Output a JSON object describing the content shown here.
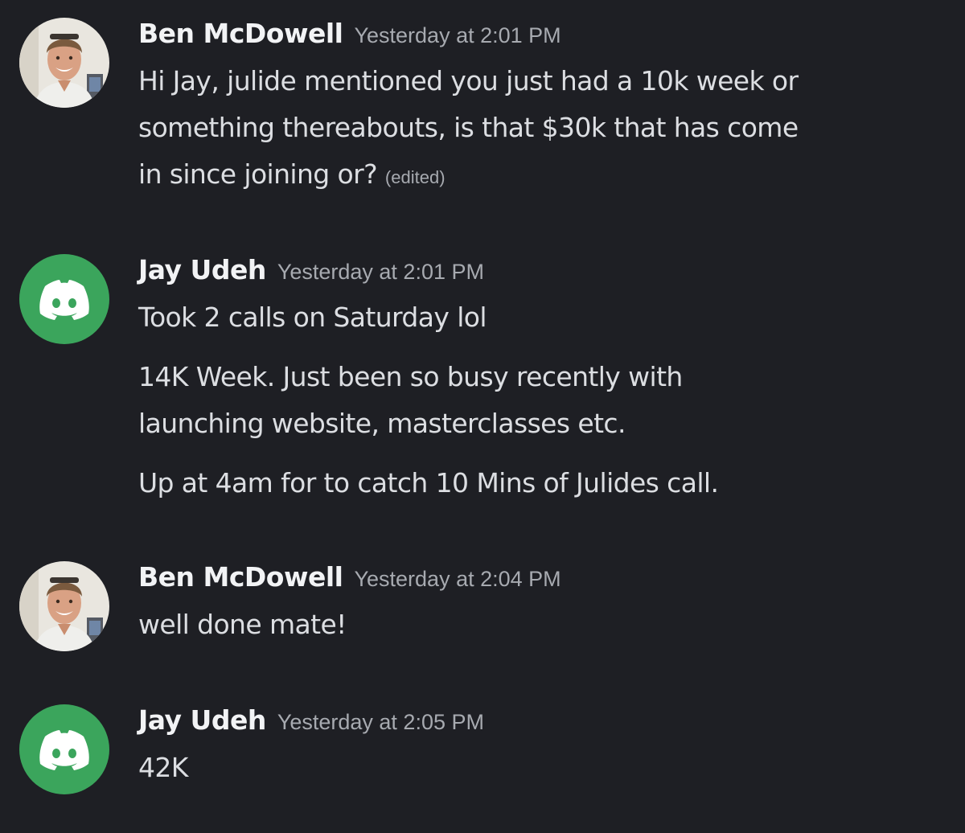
{
  "colors": {
    "background": "#1e1f24",
    "author_text": "#f2f3f5",
    "message_text": "#dcdee2",
    "timestamp_text": "#a7aab0",
    "discord_avatar_bg": "#3ba55c"
  },
  "messages": [
    {
      "author": "Ben McDowell",
      "avatar_icon": "user-photo-avatar",
      "timestamp": "Yesterday at 2:01 PM",
      "lines": [
        "Hi Jay, julide mentioned you just had a 10k week or",
        "something thereabouts, is that $30k that has come",
        "in since joining or?"
      ],
      "edited_label": "(edited)"
    },
    {
      "author": "Jay Udeh",
      "avatar_icon": "discord-logo-avatar",
      "timestamp": "Yesterday at 2:01 PM",
      "paragraphs": [
        "Took 2 calls on Saturday lol",
        "14K Week. Just been so busy recently with",
        "launching website, masterclasses etc.",
        "Up at 4am for to catch 10 Mins of Julides call."
      ]
    },
    {
      "author": "Ben McDowell",
      "avatar_icon": "user-photo-avatar",
      "timestamp": "Yesterday at 2:04 PM",
      "text": "well done mate!"
    },
    {
      "author": "Jay Udeh",
      "avatar_icon": "discord-logo-avatar",
      "timestamp": "Yesterday at 2:05 PM",
      "text": "42K"
    }
  ]
}
